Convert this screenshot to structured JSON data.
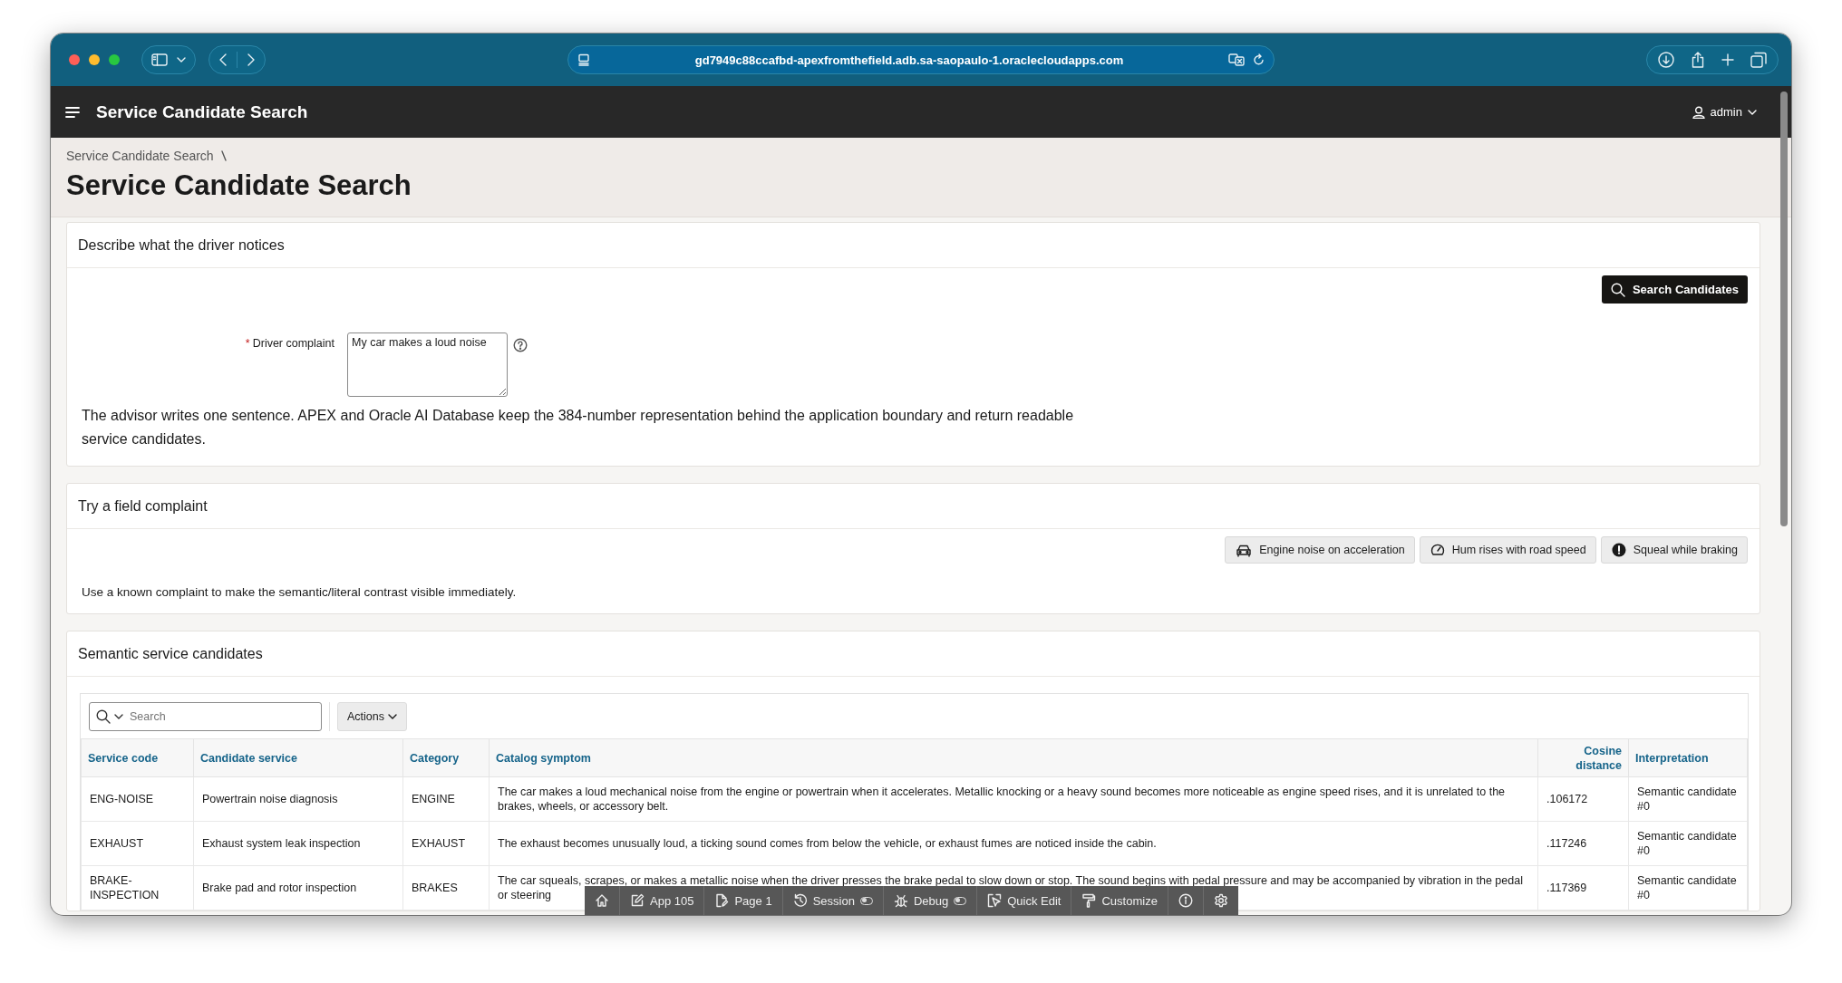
{
  "browser": {
    "url": "gd7949c88ccafbd-apexfromthefield.adb.sa-saopaulo-1.oraclecloudapps.com"
  },
  "app_header": {
    "title": "Service Candidate Search",
    "user": "admin"
  },
  "breadcrumb": [
    "Service Candidate Search"
  ],
  "page_title": "Service Candidate Search",
  "complaint_region": {
    "title": "Describe what the driver notices",
    "search_button": "Search Candidates",
    "field": {
      "required_mark": "*",
      "label": "Driver complaint",
      "value": "My car makes a loud noise"
    },
    "description": "The advisor writes one sentence. APEX and Oracle AI Database keep the 384-number representation behind the application boundary and return readable service candidates."
  },
  "examples_region": {
    "title": "Try a field complaint",
    "buttons": [
      {
        "label": "Engine noise on acceleration"
      },
      {
        "label": "Hum rises with road speed"
      },
      {
        "label": "Squeal while braking"
      }
    ],
    "description": "Use a known complaint to make the semantic/literal contrast visible immediately."
  },
  "results_region": {
    "title": "Semantic service candidates",
    "search": {
      "placeholder": "Search"
    },
    "actions_button": "Actions",
    "table": {
      "columns": [
        {
          "label": "Service code",
          "kind": "text"
        },
        {
          "label": "Candidate service",
          "kind": "text"
        },
        {
          "label": "Category",
          "kind": "text"
        },
        {
          "label": "Catalog symptom",
          "kind": "text"
        },
        {
          "label": "Cosine distance",
          "kind": "number"
        },
        {
          "label": "Interpretation",
          "kind": "text"
        }
      ],
      "rows": [
        [
          "ENG-NOISE",
          "Powertrain noise diagnosis",
          "ENGINE",
          "The car makes a loud mechanical noise from the engine or powertrain when it accelerates. Metallic knocking or a heavy sound becomes more noticeable as engine speed rises, and it is unrelated to the brakes, wheels, or accessory belt.",
          ".106172",
          "Semantic candidate #0"
        ],
        [
          "EXHAUST",
          "Exhaust system leak inspection",
          "EXHAUST",
          "The exhaust becomes unusually loud, a ticking sound comes from below the vehicle, or exhaust fumes are noticed inside the cabin.",
          ".117246",
          "Semantic candidate #0"
        ],
        [
          "BRAKE-INSPECTION",
          "Brake pad and rotor inspection",
          "BRAKES",
          "The car squeals, scrapes, or makes a metallic noise when the driver presses the brake pedal to slow down or stop. The sound begins with pedal pressure and may be accompanied by vibration in the pedal or steering",
          ".117369",
          "Semantic candidate #0"
        ]
      ]
    }
  },
  "dev_toolbar": [
    {
      "kind": "icon"
    },
    {
      "kind": "link",
      "label": "App 105"
    },
    {
      "kind": "link",
      "label": "Page 1"
    },
    {
      "kind": "toggle",
      "label": "Session",
      "on": false
    },
    {
      "kind": "toggle",
      "label": "Debug",
      "on": false
    },
    {
      "kind": "link",
      "label": "Quick Edit"
    },
    {
      "kind": "link",
      "label": "Customize"
    },
    {
      "kind": "icon"
    },
    {
      "kind": "icon"
    }
  ]
}
